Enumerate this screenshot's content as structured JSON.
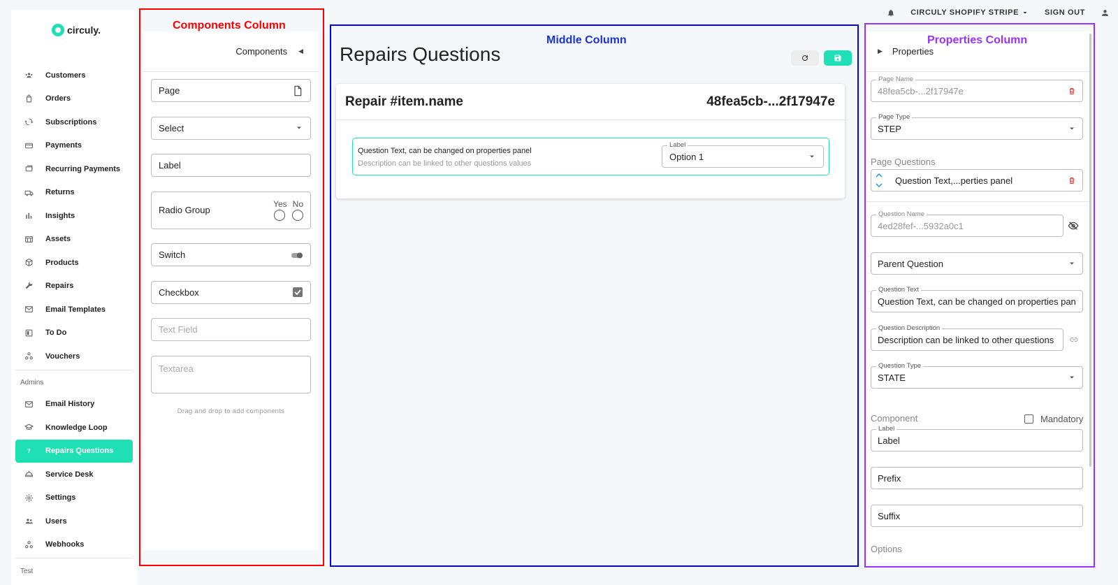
{
  "topbar": {
    "account_label": "CIRCULY SHOPIFY STRIPE",
    "signout_label": "SIGN OUT"
  },
  "sidebar": {
    "brand": "circuly.",
    "items": [
      {
        "label": "Customers",
        "icon": "customers-icon"
      },
      {
        "label": "Orders",
        "icon": "orders-icon"
      },
      {
        "label": "Subscriptions",
        "icon": "subscriptions-icon"
      },
      {
        "label": "Payments",
        "icon": "payments-icon"
      },
      {
        "label": "Recurring Payments",
        "icon": "recurring-payments-icon"
      },
      {
        "label": "Returns",
        "icon": "returns-icon"
      },
      {
        "label": "Insights",
        "icon": "insights-icon"
      },
      {
        "label": "Assets",
        "icon": "assets-icon"
      },
      {
        "label": "Products",
        "icon": "products-icon"
      },
      {
        "label": "Repairs",
        "icon": "wrench-icon"
      },
      {
        "label": "Email Templates",
        "icon": "mail-icon"
      },
      {
        "label": "To Do",
        "icon": "todo-icon"
      },
      {
        "label": "Vouchers",
        "icon": "vouchers-icon"
      }
    ],
    "admins_label": "Admins",
    "admin_items": [
      {
        "label": "Email History",
        "icon": "mail-icon"
      },
      {
        "label": "Knowledge Loop",
        "icon": "graduation-cap-icon"
      },
      {
        "label": "Repairs Questions",
        "icon": "question-icon",
        "active": true
      },
      {
        "label": "Service Desk",
        "icon": "service-desk-icon"
      },
      {
        "label": "Settings",
        "icon": "gear-icon"
      },
      {
        "label": "Users",
        "icon": "users-icon"
      },
      {
        "label": "Webhooks",
        "icon": "webhooks-icon"
      }
    ],
    "test_label": "Test"
  },
  "annotations": {
    "components_title": "Components Column",
    "middle_title": "Middle Column",
    "properties_title": "Properties Column",
    "components_color": "#ff0000",
    "middle_color": "#0000ff",
    "properties_color": "#9933ff"
  },
  "components": {
    "header": "Components",
    "page_label": "Page",
    "select_label": "Select",
    "label_label": "Label",
    "radio_label": "Radio Group",
    "radio_yes": "Yes",
    "radio_no": "No",
    "switch_label": "Switch",
    "checkbox_label": "Checkbox",
    "textfield_label": "Text Field",
    "textarea_label": "Textarea",
    "hint": "Drag and drop to add components"
  },
  "middle": {
    "title": "Repairs Questions",
    "card_title": "Repair #item.name",
    "card_id": "48fea5cb-...2f17947e",
    "question_text": "Question Text, can be changed on properties panel",
    "question_desc": "Description can be linked to other questions values",
    "select_label": "Label",
    "select_value": "Option 1"
  },
  "properties": {
    "header": "Properties",
    "page_name_label": "Page Name",
    "page_name_value": "48fea5cb-...2f17947e",
    "page_type_label": "Page Type",
    "page_type_value": "STEP",
    "page_questions_label": "Page Questions",
    "page_question_item": "Question Text,...perties panel",
    "question_name_label": "Question Name",
    "question_name_value": "4ed28fef-...5932a0c1",
    "parent_question_label": "Parent Question",
    "question_text_label": "Question Text",
    "question_text_value": "Question Text, can be changed on properties panel",
    "question_desc_label": "Question Description",
    "question_desc_value": "Description can be linked to other questions values",
    "question_type_label": "Question Type",
    "question_type_value": "STATE",
    "component_label": "Component",
    "mandatory_label": "Mandatory",
    "comp_label_label": "Label",
    "comp_label_value": "Label",
    "prefix_label": "Prefix",
    "suffix_label": "Suffix",
    "options_label": "Options"
  },
  "colors": {
    "accent": "#1ee0b4",
    "delete": "#e53935"
  }
}
